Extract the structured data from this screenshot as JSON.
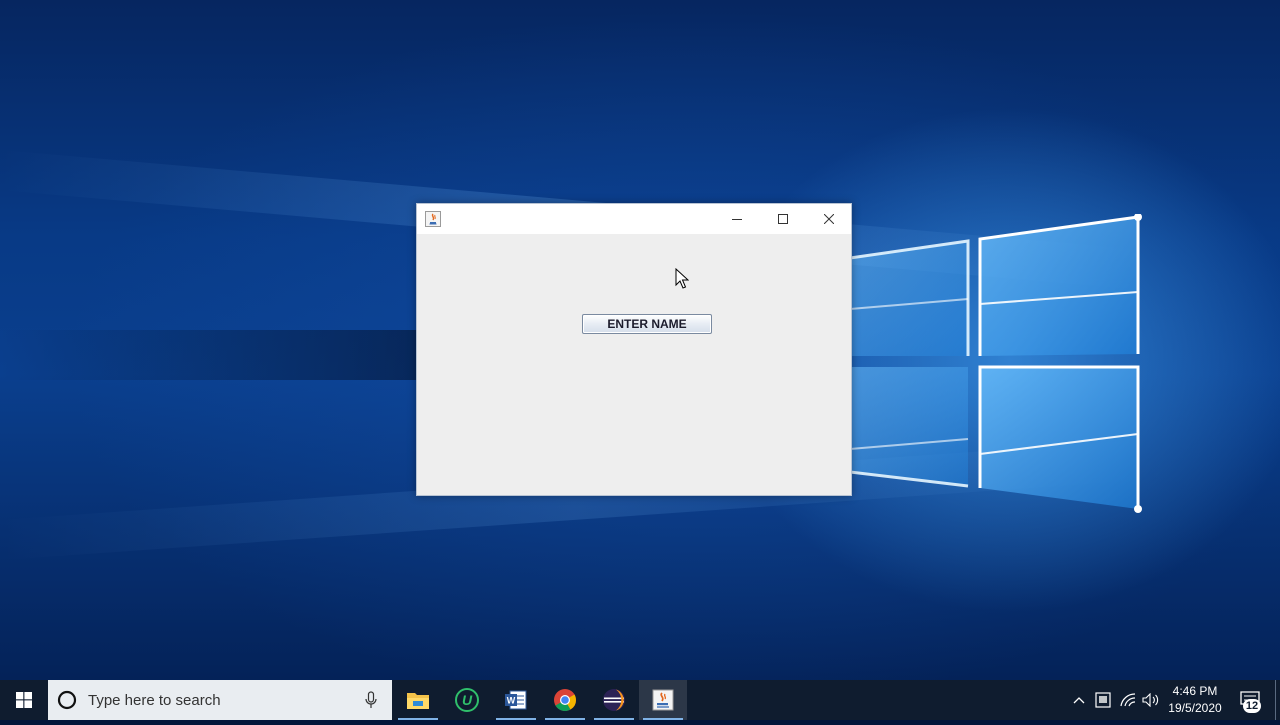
{
  "colors": {
    "taskbar": "#0f1c2f",
    "search_bg": "#e9edf1",
    "window_bg": "#eeeeee",
    "accent": "#7fb2e6"
  },
  "window": {
    "title": "",
    "icon": "java-app-icon",
    "controls": [
      "minimize-icon",
      "maximize-icon",
      "close-icon"
    ],
    "button_label": "ENTER NAME"
  },
  "taskbar": {
    "search_placeholder": "Type here to search",
    "apps": [
      {
        "name": "file-explorer",
        "icon": "folder-icon"
      },
      {
        "name": "utorrent",
        "icon": "utorrent-icon"
      },
      {
        "name": "word",
        "icon": "word-icon"
      },
      {
        "name": "chrome",
        "icon": "chrome-icon"
      },
      {
        "name": "eclipse",
        "icon": "eclipse-icon"
      },
      {
        "name": "java",
        "icon": "java-icon"
      }
    ],
    "tray": {
      "time": "4:46 PM",
      "date": "19/5/2020",
      "notification_count": "12"
    }
  }
}
